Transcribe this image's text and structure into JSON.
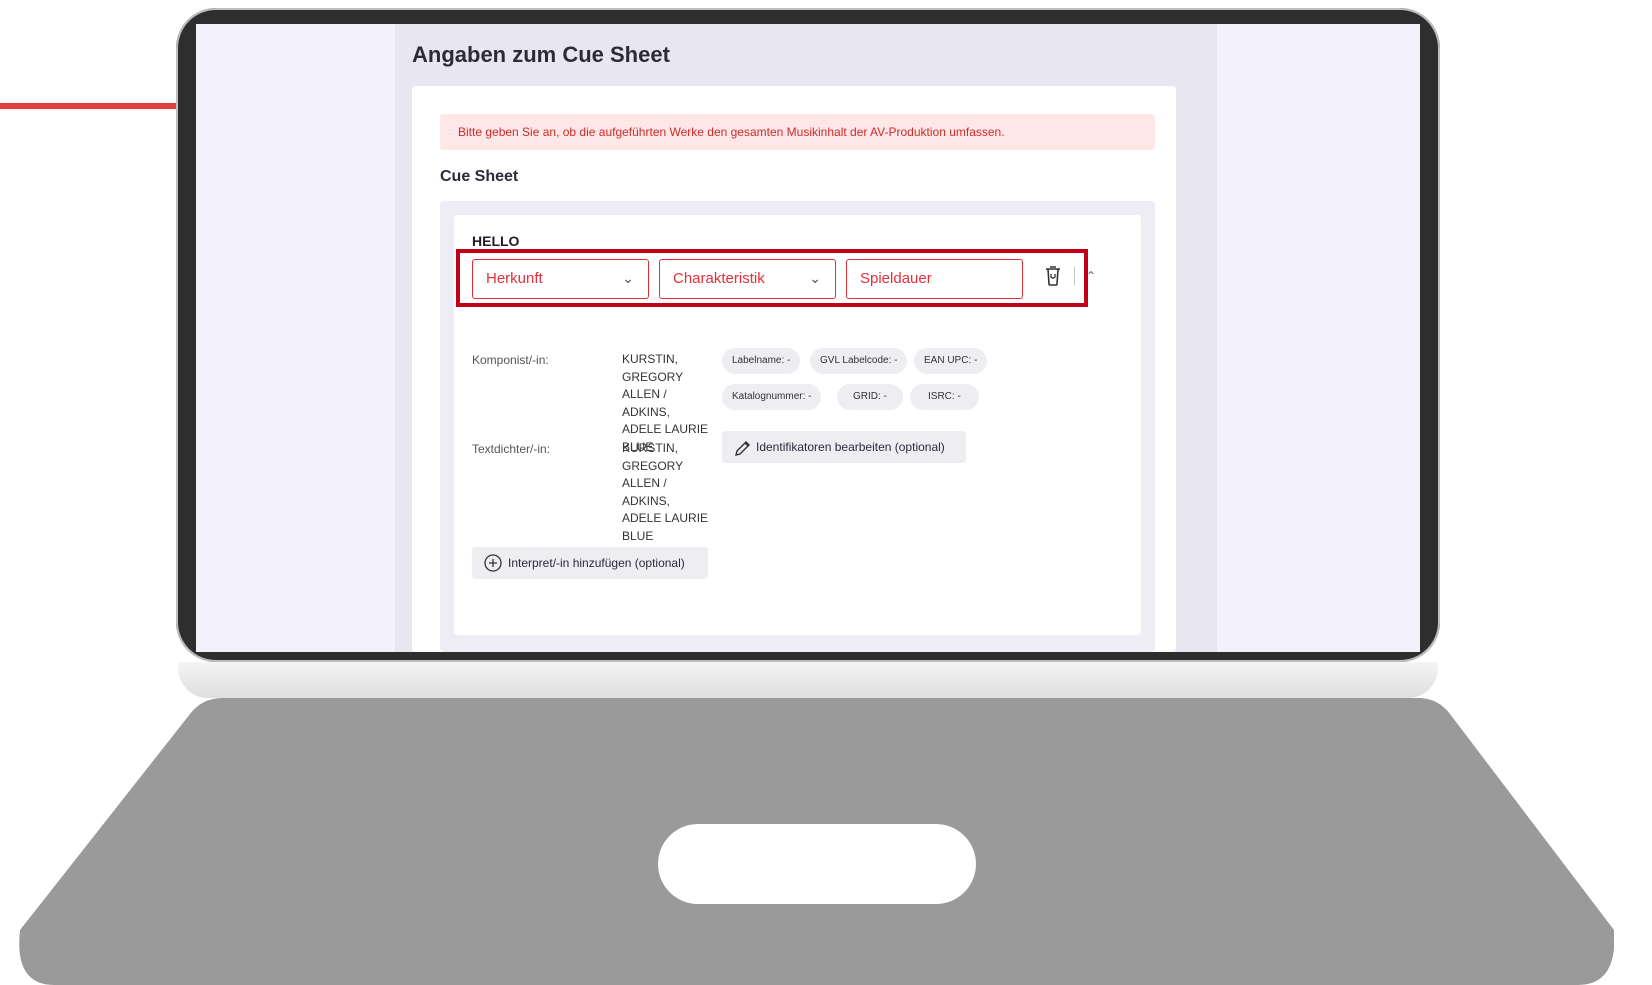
{
  "page": {
    "title": "Angaben zum Cue Sheet",
    "alert": "Bitte geben Sie an, ob die aufgeführten Werke den gesamten Musikinhalt der AV-Produktion umfassen.",
    "section_title": "Cue Sheet"
  },
  "work": {
    "title": "HELLO",
    "fields": {
      "herkunft": "Herkunft",
      "charakteristik": "Charakteristik",
      "spieldauer": "Spieldauer"
    },
    "composer_label": "Komponist/-in:",
    "composer_value": "KURSTIN, GREGORY ALLEN / ADKINS, ADELE LAURIE BLUE",
    "lyricist_label": "Textdichter/-in:",
    "lyricist_value": "KURSTIN, GREGORY ALLEN / ADKINS, ADELE LAURIE BLUE",
    "chips": {
      "labelname": "Labelname: -",
      "gvl_labelcode": "GVL Labelcode: -",
      "ean_upc": "EAN UPC: -",
      "katalognummer": "Katalognummer: -",
      "grid": "GRID: -",
      "isrc": "ISRC: -"
    },
    "edit_identifiers": "Identifikatoren bearbeiten (optional)",
    "add_performer": "Interpret/-in hinzufügen (optional)"
  },
  "colors": {
    "accent_red": "#e0303a",
    "highlight_red": "#c00018",
    "alert_bg": "#fde7e7",
    "arrow_red": "#e0403f"
  },
  "icons": [
    "chevron-down-icon",
    "trash-icon",
    "chevron-up-icon",
    "pencil-icon",
    "plus-circle-icon",
    "arrow-right-icon"
  ]
}
